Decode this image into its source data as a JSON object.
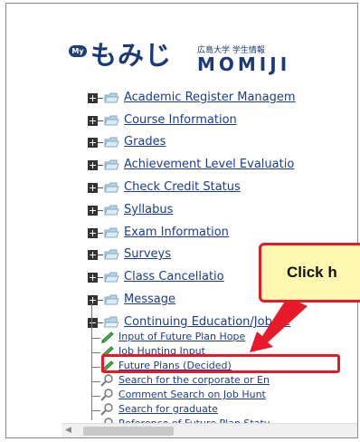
{
  "logo": {
    "my": "My",
    "name_jp": "もみじ",
    "subtitle_jp": "広島大学 学生情報",
    "name_en": "MOMIJI"
  },
  "menu": {
    "items": [
      {
        "label": "Academic Register Managem"
      },
      {
        "label": "Course Information"
      },
      {
        "label": "Grades"
      },
      {
        "label": "Achievement Level Evaluatio"
      },
      {
        "label": "Check Credit Status"
      },
      {
        "label": "Syllabus"
      },
      {
        "label": "Exam Information"
      },
      {
        "label": "Surveys"
      },
      {
        "label": "Class Cancellatio"
      },
      {
        "label": "Message"
      },
      {
        "label": "Continuing Education/Job Se"
      }
    ],
    "subitems": [
      {
        "label": "Input of Future Plan Hope",
        "icon": "pencil-icon"
      },
      {
        "label": "Job Hunting Input",
        "icon": "pencil-icon"
      },
      {
        "label": "Future Plans (Decided)",
        "icon": "pencil-icon"
      },
      {
        "label": "Search for the corporate or En",
        "icon": "magnifier-icon"
      },
      {
        "label": "Comment Search on Job Hunt",
        "icon": "magnifier-icon"
      },
      {
        "label": "Search for graduate",
        "icon": "magnifier-icon"
      },
      {
        "label": "Reference of Future Plan Statu",
        "icon": "magnifier-icon"
      }
    ]
  },
  "callout": {
    "text": "Click h"
  },
  "colors": {
    "link": "#1a3d8f",
    "highlight": "#e8192b",
    "callout_bg": "#fff8b2",
    "logo": "#1c3a75"
  }
}
